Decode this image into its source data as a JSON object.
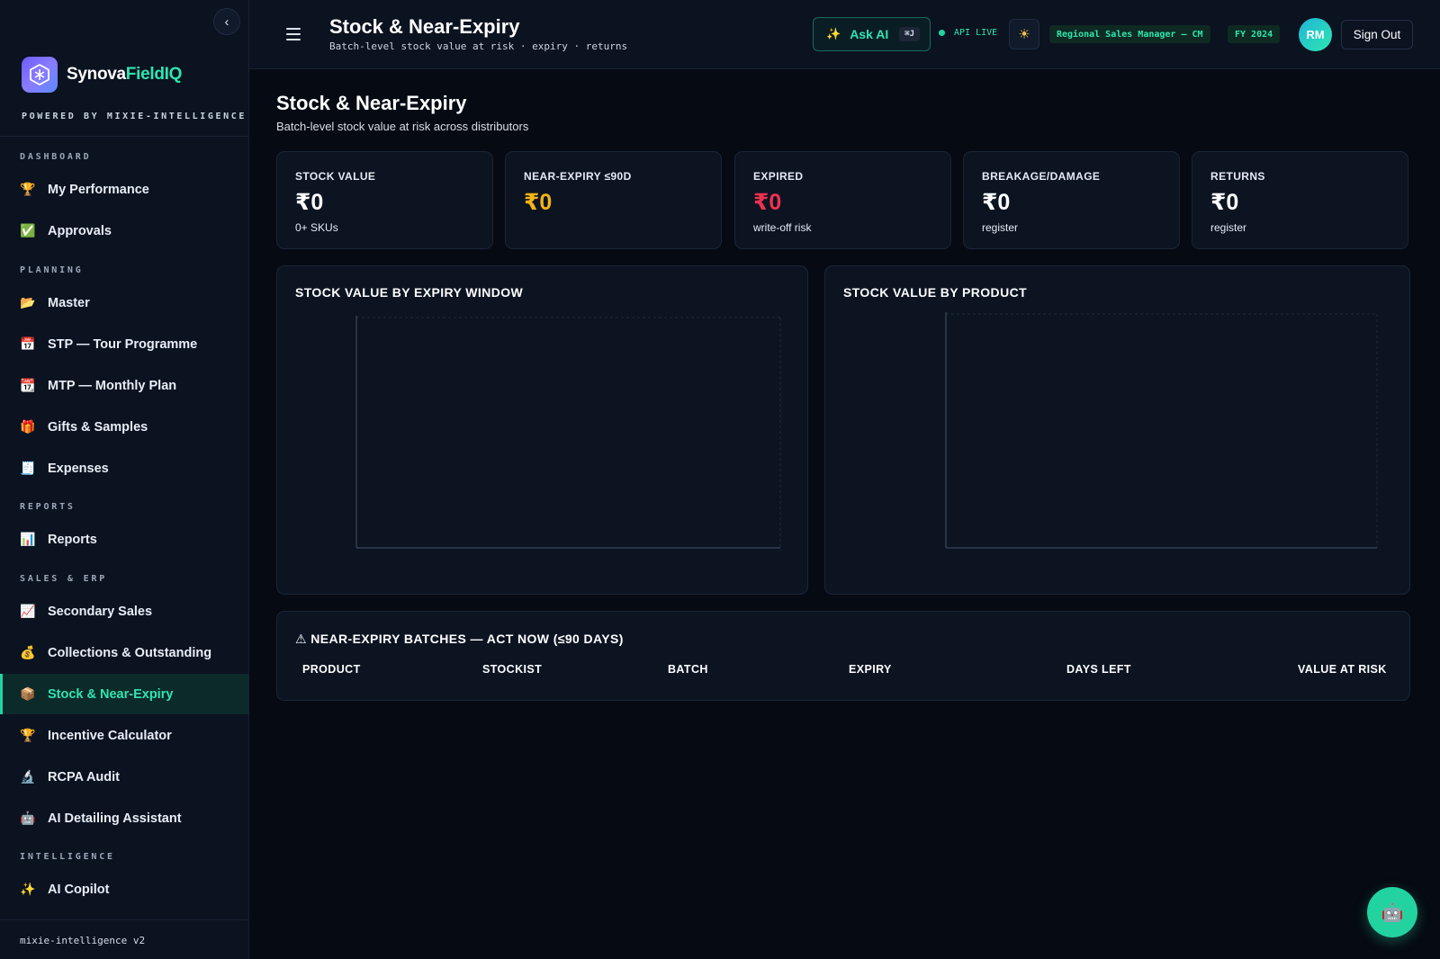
{
  "sidebar": {
    "brand": {
      "name_part1": "Synova",
      "name_part2": "FieldIQ",
      "powered_by": "POWERED BY MIXIE-INTELLIGENCE"
    },
    "sections": {
      "dashboard": "DASHBOARD",
      "planning": "PLANNING",
      "reports": "REPORTS",
      "sales_erp": "SALES & ERP",
      "intelligence": "INTELLIGENCE"
    },
    "items": [
      {
        "label": "My Performance",
        "icon": "trophy-icon"
      },
      {
        "label": "Approvals",
        "icon": "check-box-icon"
      },
      {
        "label": "Master",
        "icon": "folder-icon"
      },
      {
        "label": "STP — Tour Programme",
        "icon": "calendar-icon"
      },
      {
        "label": "MTP — Monthly Plan",
        "icon": "calendar-date-icon"
      },
      {
        "label": "Gifts & Samples",
        "icon": "gift-icon"
      },
      {
        "label": "Expenses",
        "icon": "receipt-icon"
      },
      {
        "label": "Reports",
        "icon": "bar-chart-icon"
      },
      {
        "label": "Secondary Sales",
        "icon": "trend-chart-icon"
      },
      {
        "label": "Collections & Outstanding",
        "icon": "money-bag-icon"
      },
      {
        "label": "Stock & Near-Expiry",
        "icon": "package-icon",
        "active": true
      },
      {
        "label": "Incentive Calculator",
        "icon": "trophy-icon"
      },
      {
        "label": "RCPA Audit",
        "icon": "microscope-icon"
      },
      {
        "label": "AI Detailing Assistant",
        "icon": "robot-icon"
      },
      {
        "label": "AI Copilot",
        "icon": "sparkle-icon"
      }
    ],
    "footer": "mixie-intelligence v2"
  },
  "header": {
    "title": "Stock & Near-Expiry",
    "subtitle": "Batch-level stock value at risk · expiry · returns",
    "ask_ai": "Ask AI",
    "shortcut": "⌘J",
    "api_status": "API LIVE",
    "role": "Regional Sales Manager — CM",
    "fy": "FY 2024",
    "avatar_initials": "RM",
    "sign_out": "Sign Out"
  },
  "page": {
    "title": "Stock & Near-Expiry",
    "subtitle": "Batch-level stock value at risk across distributors"
  },
  "kpis": [
    {
      "label": "STOCK VALUE",
      "value": "₹0",
      "note": "0+ SKUs",
      "color": "#ffffff"
    },
    {
      "label": "NEAR-EXPIRY ≤90D",
      "value": "₹0",
      "note": "",
      "color": "#f5b316"
    },
    {
      "label": "EXPIRED",
      "value": "₹0",
      "note": "write-off risk",
      "color": "#f0314f"
    },
    {
      "label": "BREAKAGE/DAMAGE",
      "value": "₹0",
      "note": "register",
      "color": "#ffffff"
    },
    {
      "label": "RETURNS",
      "value": "₹0",
      "note": "register",
      "color": "#ffffff"
    }
  ],
  "charts": {
    "expiry_window_title": "STOCK VALUE BY EXPIRY WINDOW",
    "product_title": "STOCK VALUE BY PRODUCT"
  },
  "chart_data": [
    {
      "type": "bar",
      "title": "STOCK VALUE BY EXPIRY WINDOW",
      "categories": [],
      "values": []
    },
    {
      "type": "bar",
      "title": "STOCK VALUE BY PRODUCT",
      "categories": [],
      "values": []
    }
  ],
  "table": {
    "title": "⚠ NEAR-EXPIRY BATCHES — ACT NOW (≤90 DAYS)",
    "columns": [
      "PRODUCT",
      "STOCKIST",
      "BATCH",
      "EXPIRY",
      "DAYS LEFT",
      "VALUE AT RISK"
    ],
    "rows": []
  },
  "colors": {
    "accent": "#2ee6b0",
    "warning": "#f5b316",
    "danger": "#f0314f",
    "background": "#060a12"
  }
}
